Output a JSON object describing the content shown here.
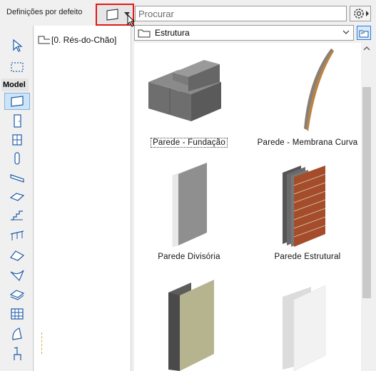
{
  "toolbar": {
    "defaults_label": "Definições por defeito"
  },
  "search": {
    "placeholder": "Procurar"
  },
  "toolbox": {
    "section_label": "Model",
    "tools": [
      "arrow-icon",
      "marquee-icon",
      "wall-tool-icon",
      "door-tool-icon",
      "window-tool-icon",
      "column-tool-icon",
      "beam-tool-icon",
      "slab-tool-icon",
      "stair-tool-icon",
      "railing-tool-icon",
      "roof-tool-icon",
      "shell-tool-icon",
      "mesh-tool-icon",
      "curtain-wall-tool-icon",
      "morph-tool-icon",
      "object-tool-icon"
    ]
  },
  "navigator": {
    "story_label": "[0. Rés-do-Chão]"
  },
  "folder": {
    "current": "Estrutura"
  },
  "library": {
    "items": [
      {
        "label": "Parede - Fundação",
        "selected": true
      },
      {
        "label": "Parede - Membrana Curva"
      },
      {
        "label": "Parede Divisória"
      },
      {
        "label": "Parede Estrutural"
      },
      {
        "label": ""
      },
      {
        "label": ""
      }
    ]
  },
  "colors": {
    "highlight_frame": "#e21a1a",
    "active_tool": "#cde4f7",
    "accent_blue": "#2a7ad6"
  }
}
